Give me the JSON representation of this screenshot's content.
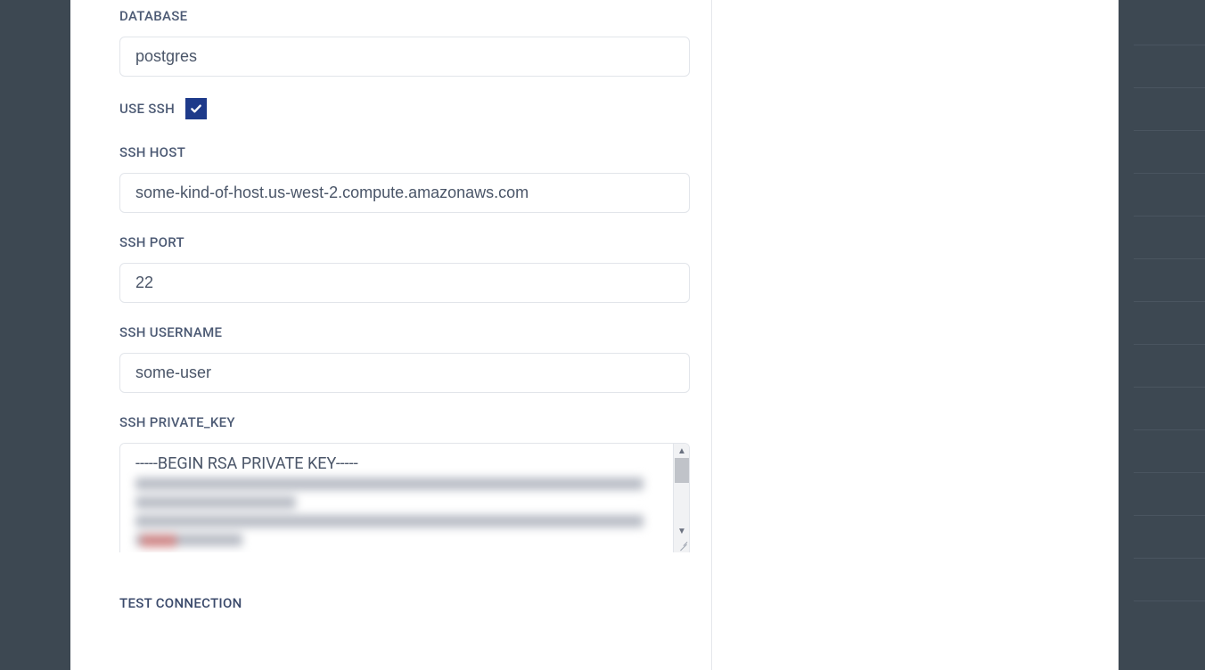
{
  "form": {
    "database_label": "DATABASE",
    "database_value": "postgres",
    "use_ssh_label": "USE SSH",
    "use_ssh_checked": true,
    "ssh_host_label": "SSH HOST",
    "ssh_host_value": "some-kind-of-host.us-west-2.compute.amazonaws.com",
    "ssh_port_label": "SSH PORT",
    "ssh_port_value": "22",
    "ssh_username_label": "SSH USERNAME",
    "ssh_username_value": "some-user",
    "ssh_private_key_label": "SSH PRIVATE_KEY",
    "ssh_private_key_value": "-----BEGIN RSA PRIVATE KEY-----",
    "test_connection_label": "TEST CONNECTION"
  }
}
